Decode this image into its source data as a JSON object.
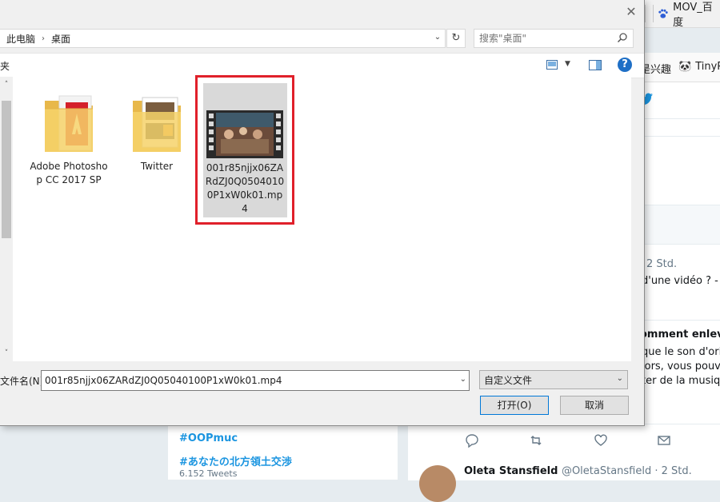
{
  "browser": {
    "tab_title": "MOV_百度",
    "bookmarks": [
      {
        "label": "是兴趣"
      },
      {
        "label": "TinyP"
      }
    ]
  },
  "dialog": {
    "breadcrumb": [
      "此电脑",
      "桌面"
    ],
    "search_placeholder": "搜索\"桌面\"",
    "toolbar_left_label": "夹",
    "files": [
      {
        "label": "Adobe Photoshop CC 2017 SP",
        "icon": "adobe-folder-icon"
      },
      {
        "label": "Twitter",
        "icon": "folder-icon"
      },
      {
        "label": "001r85njjx06ZARdZJ0Q05040100P1xW0k01.mp4",
        "icon": "video-file-icon",
        "selected": true
      }
    ],
    "filename_label": "文件名(N):",
    "filename_value": "001r85njjx06ZARdZJ0Q05040100P1xW0k01.mp4",
    "filetype_value": "自定义文件",
    "open_button": "打开(O)",
    "cancel_button": "取消"
  },
  "background": {
    "time_1": "2 Std.",
    "text_1": "d'une vidéo ? -",
    "heading_2": "omment enleve",
    "line_2a": "que le son d'orig",
    "line_2b": "lors, vous pouve",
    "line_2c": "ter de la musique",
    "trends": [
      {
        "tag": "#OOPmuc"
      },
      {
        "tag": "#あなたの北方領土交渉",
        "count": "6.152 Tweets"
      }
    ],
    "tweet_name": "Oleta Stansfield",
    "tweet_handle": "@OletaStansfield · 2 Std."
  },
  "colors": {
    "highlight_red": "#e0202a",
    "twitter_blue": "#1b95e0",
    "help_blue": "#1e6fc6"
  }
}
